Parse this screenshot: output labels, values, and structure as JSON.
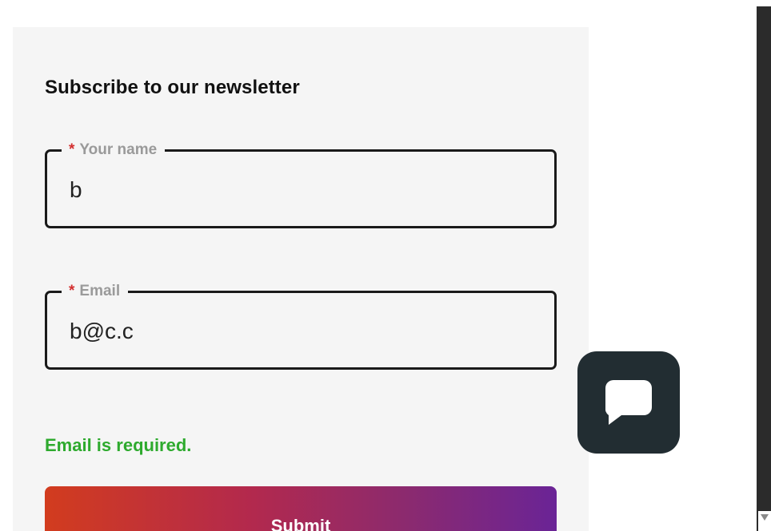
{
  "form": {
    "title": "Subscribe to our newsletter",
    "name_field": {
      "required_marker": "*",
      "label": "Your name",
      "value": "b"
    },
    "email_field": {
      "required_marker": "*",
      "label": "Email",
      "value": "b@c.c"
    },
    "error_message": "Email is required.",
    "submit_label": "Submit"
  },
  "widgets": {
    "chat_icon": "chat-bubble-icon"
  },
  "colors": {
    "card_background": "#f5f5f5",
    "required_marker": "#d32f2f",
    "error_text": "#2eaa2e",
    "submit_gradient_start": "#d23c1e",
    "submit_gradient_end": "#6a2496",
    "chat_button_background": "#222d32"
  }
}
